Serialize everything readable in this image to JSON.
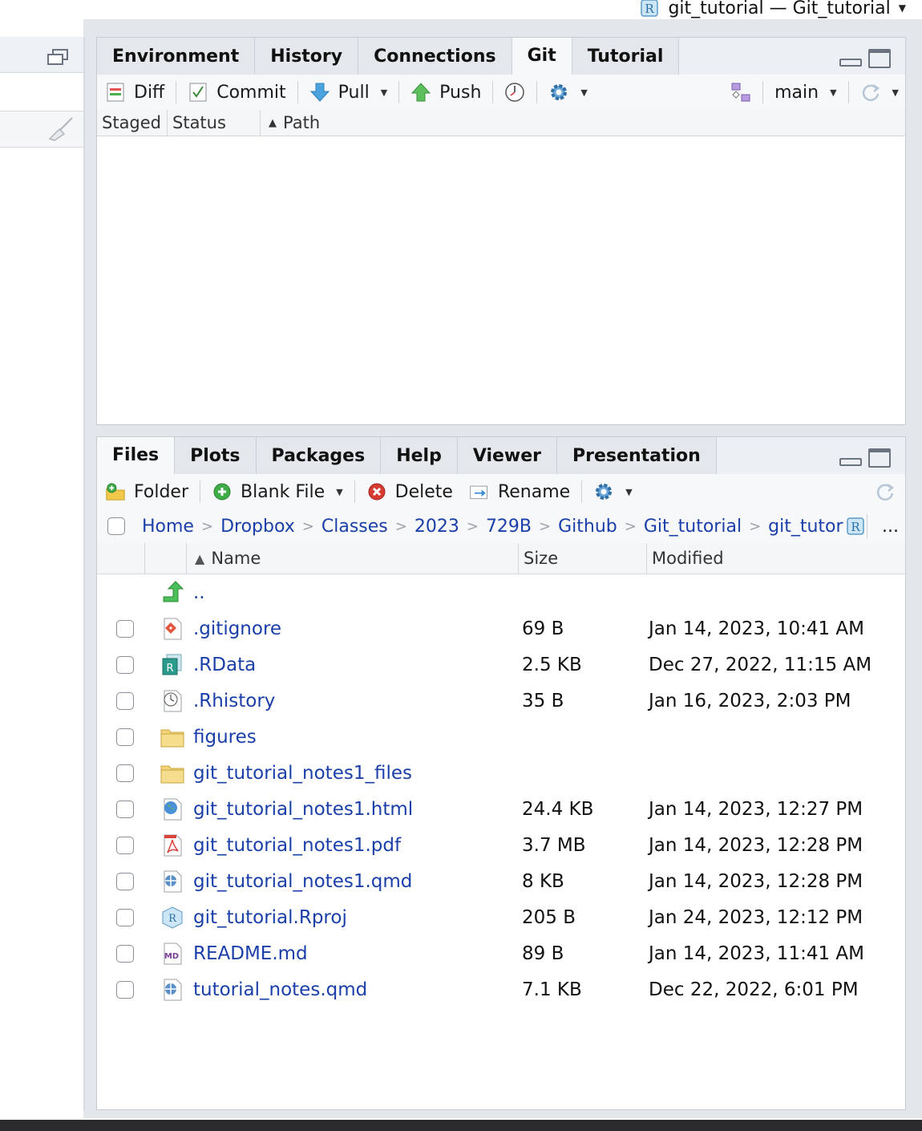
{
  "window": {
    "project_title": "git_tutorial — Git_tutorial"
  },
  "top_pane": {
    "tabs": [
      "Environment",
      "History",
      "Connections",
      "Git",
      "Tutorial"
    ],
    "active_tab": "Git",
    "toolbar": {
      "diff": "Diff",
      "commit": "Commit",
      "pull": "Pull",
      "push": "Push",
      "branch": "main"
    },
    "columns": {
      "staged": "Staged",
      "status": "Status",
      "path": "Path"
    }
  },
  "bottom_pane": {
    "tabs": [
      "Files",
      "Plots",
      "Packages",
      "Help",
      "Viewer",
      "Presentation"
    ],
    "active_tab": "Files",
    "toolbar": {
      "folder": "Folder",
      "blank_file": "Blank File",
      "delete": "Delete",
      "rename": "Rename"
    },
    "breadcrumb": [
      "Home",
      "Dropbox",
      "Classes",
      "2023",
      "729B",
      "Github",
      "Git_tutorial",
      "git_tutor"
    ],
    "more": "...",
    "columns": {
      "name": "Name",
      "size": "Size",
      "modified": "Modified"
    },
    "parent": "..",
    "files": [
      {
        "name": ".gitignore",
        "size": "69 B",
        "modified": "Jan 14, 2023, 10:41 AM",
        "icon": "git-file-icon"
      },
      {
        "name": ".RData",
        "size": "2.5 KB",
        "modified": "Dec 27, 2022, 11:15 AM",
        "icon": "rdata-icon"
      },
      {
        "name": ".Rhistory",
        "size": "35 B",
        "modified": "Jan 16, 2023, 2:03 PM",
        "icon": "history-file-icon"
      },
      {
        "name": "figures",
        "size": "",
        "modified": "",
        "icon": "folder-icon"
      },
      {
        "name": "git_tutorial_notes1_files",
        "size": "",
        "modified": "",
        "icon": "folder-icon"
      },
      {
        "name": "git_tutorial_notes1.html",
        "size": "24.4 KB",
        "modified": "Jan 14, 2023, 12:27 PM",
        "icon": "html-file-icon"
      },
      {
        "name": "git_tutorial_notes1.pdf",
        "size": "3.7 MB",
        "modified": "Jan 14, 2023, 12:28 PM",
        "icon": "pdf-file-icon"
      },
      {
        "name": "git_tutorial_notes1.qmd",
        "size": "8 KB",
        "modified": "Jan 14, 2023, 12:28 PM",
        "icon": "qmd-file-icon"
      },
      {
        "name": "git_tutorial.Rproj",
        "size": "205 B",
        "modified": "Jan 24, 2023, 12:12 PM",
        "icon": "rproj-file-icon"
      },
      {
        "name": "README.md",
        "size": "89 B",
        "modified": "Jan 14, 2023, 11:41 AM",
        "icon": "markdown-file-icon"
      },
      {
        "name": "tutorial_notes.qmd",
        "size": "7.1 KB",
        "modified": "Dec 22, 2022, 6:01 PM",
        "icon": "qmd-file-icon"
      }
    ]
  },
  "colors": {
    "link": "#1a3fa8",
    "pane_border": "#c7ccd2",
    "tab_bg": "#e4e8ec"
  }
}
